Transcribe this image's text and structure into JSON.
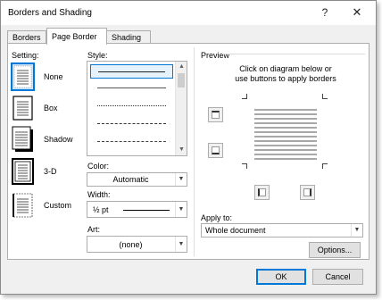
{
  "window": {
    "title": "Borders and Shading",
    "help_label": "?",
    "close_label": "✕"
  },
  "tabs": [
    {
      "label": "Borders"
    },
    {
      "label": "Page Border"
    },
    {
      "label": "Shading"
    }
  ],
  "active_tab": "Page Border",
  "setting": {
    "label": "Setting:",
    "options": [
      {
        "label": "None"
      },
      {
        "label": "Box"
      },
      {
        "label": "Shadow"
      },
      {
        "label": "3-D"
      },
      {
        "label": "Custom"
      }
    ],
    "selected": "None"
  },
  "style": {
    "label": "Style:"
  },
  "color": {
    "label": "Color:",
    "value": "Automatic"
  },
  "width": {
    "label": "Width:",
    "value": "½ pt"
  },
  "art": {
    "label": "Art:",
    "value": "(none)"
  },
  "preview": {
    "label": "Preview",
    "instruction_line1": "Click on diagram below or",
    "instruction_line2": "use buttons to apply borders"
  },
  "apply_to": {
    "label": "Apply to:",
    "value": "Whole document"
  },
  "buttons": {
    "options": "Options...",
    "ok": "OK",
    "cancel": "Cancel"
  },
  "icons": [
    "help-icon",
    "close-icon",
    "chevron-down-icon",
    "scroll-up-icon",
    "scroll-down-icon",
    "border-top-icon",
    "border-bottom-icon",
    "border-left-icon",
    "border-right-icon"
  ],
  "colors": {
    "accent": "#0078d7",
    "panel_bg": "#ffffff",
    "dialog_bg": "#f0f0f0"
  }
}
